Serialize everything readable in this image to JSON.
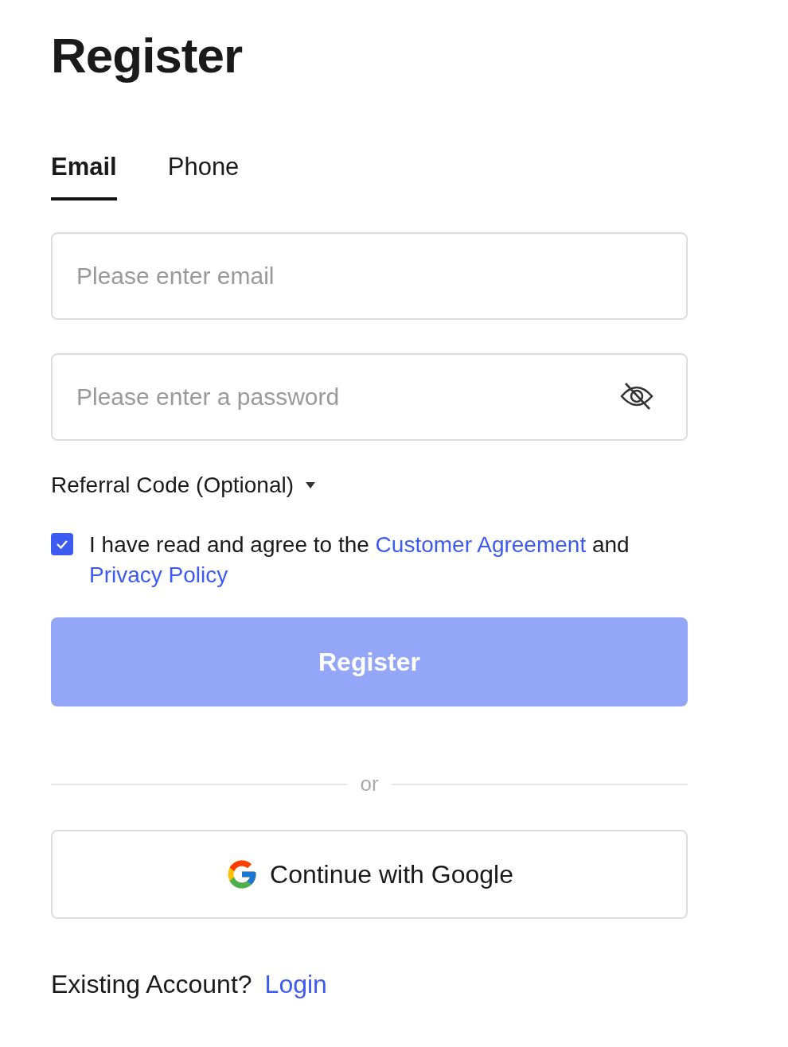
{
  "title": "Register",
  "tabs": [
    {
      "label": "Email",
      "selected": true
    },
    {
      "label": "Phone",
      "selected": false
    }
  ],
  "email_field": {
    "placeholder": "Please enter email"
  },
  "password_field": {
    "placeholder": "Please enter a password"
  },
  "referral": {
    "label": "Referral Code (Optional)",
    "expanded": false
  },
  "agreement": {
    "checked": true,
    "text": "I have read and agree to the",
    "link_1": "Customer Agreement",
    "joiner": "and",
    "link_2": "Privacy Policy"
  },
  "register_button": {
    "label": "Register",
    "disabled": true
  },
  "divider": {
    "label": "or"
  },
  "google_button": {
    "label": "Continue with Google"
  },
  "footer": {
    "text": "Existing Account?",
    "link": "Login"
  }
}
